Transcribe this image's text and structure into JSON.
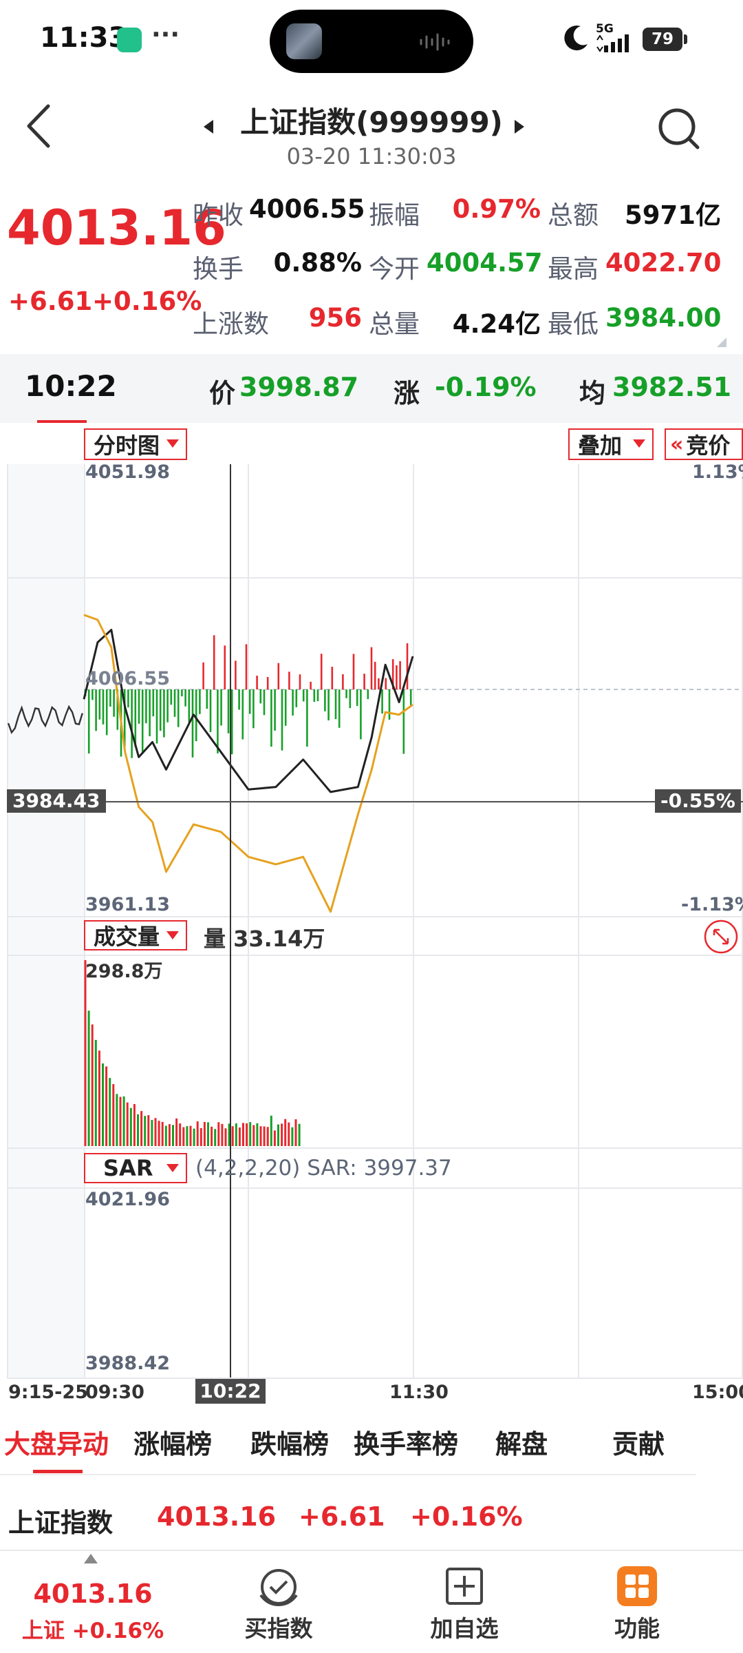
{
  "status": {
    "time": "11:33",
    "more": "···",
    "network": "5G",
    "battery": "79"
  },
  "header": {
    "title": "上证指数(999999)",
    "datetime": "03-20 11:30:03"
  },
  "quote": {
    "price": "4013.16",
    "change": "+6.61",
    "change_pct": "+0.16%",
    "rows": [
      [
        {
          "label": "昨收",
          "value": "4006.55",
          "color": "black"
        },
        {
          "label": "振幅",
          "value": "0.97%",
          "color": "red"
        },
        {
          "label": "总额",
          "value": "5971亿",
          "color": "black"
        }
      ],
      [
        {
          "label": "换手",
          "value": "0.88%",
          "color": "black"
        },
        {
          "label": "今开",
          "value": "4004.57",
          "color": "green"
        },
        {
          "label": "最高",
          "value": "4022.70",
          "color": "red"
        }
      ],
      [
        {
          "label": "上涨数",
          "value": "956",
          "color": "red"
        },
        {
          "label": "总量",
          "value": "4.24亿",
          "color": "black"
        },
        {
          "label": "最低",
          "value": "3984.00",
          "color": "green"
        }
      ]
    ]
  },
  "crosshair": {
    "time": "10:22",
    "price_label": "价",
    "price": "3998.87",
    "change_label": "涨",
    "change": "-0.19%",
    "avg_label": "均",
    "avg": "3982.51",
    "axis_price": "3984.43",
    "axis_pct": "-0.55%"
  },
  "chart": {
    "mode": "分时图",
    "overlay": "叠加",
    "auction": "竞价",
    "y_max": "4051.98",
    "y_mid": "4006.55",
    "y_min": "3961.13",
    "pct_max": "1.13%",
    "pct_min": "-1.13%",
    "volume_indicator": "成交量",
    "volume_value_label": "量 33.14万",
    "volume_max": "298.8万",
    "sar_indicator": "SAR",
    "sar_params": "(4,2,2,20) SAR: 3997.37",
    "sar_max": "4021.96",
    "sar_min": "3988.42",
    "x_labels": [
      "9:15-25",
      "09:30",
      "11:30",
      "15:00"
    ],
    "x_cursor": "10:22"
  },
  "chart_data": {
    "type": "line",
    "title": "上证指数(999999)",
    "y_range": [
      3961.13,
      4051.98
    ],
    "prev_close": 4006.55,
    "series": [
      {
        "name": "上证指数",
        "color": "#222222",
        "x": [
          "09:30",
          "09:35",
          "09:40",
          "09:45",
          "09:50",
          "09:55",
          "10:00",
          "10:10",
          "10:20",
          "10:30",
          "10:40",
          "10:50",
          "11:00",
          "11:10",
          "11:15",
          "11:20",
          "11:25",
          "11:30"
        ],
        "values": [
          4004.6,
          4016.0,
          4018.5,
          4003.0,
          3993.0,
          3996.0,
          3990.5,
          4001.5,
          3994.0,
          3986.5,
          3987.0,
          3992.5,
          3986.0,
          3987.0,
          3997.0,
          4011.5,
          4004.0,
          4013.2
        ]
      },
      {
        "name": "均价",
        "color": "#e6a11e",
        "x": [
          "09:30",
          "09:35",
          "09:40",
          "09:45",
          "09:50",
          "09:55",
          "10:00",
          "10:10",
          "10:20",
          "10:30",
          "10:40",
          "10:50",
          "11:00",
          "11:10",
          "11:15",
          "11:20",
          "11:25",
          "11:30"
        ],
        "values": [
          4021.5,
          4020.5,
          4015.0,
          3994.0,
          3983.0,
          3980.0,
          3970.0,
          3979.5,
          3978.0,
          3973.0,
          3971.5,
          3973.0,
          3962.0,
          3981.5,
          3990.5,
          4002.0,
          4001.5,
          4003.5
        ]
      }
    ]
  },
  "tabs": [
    "大盘异动",
    "涨幅榜",
    "跌幅榜",
    "换手率榜",
    "解盘",
    "贡献"
  ],
  "ticker": {
    "name": "上证指数",
    "price": "4013.16",
    "change": "+6.61",
    "change_pct": "+0.16%"
  },
  "bottom_nav": {
    "price": "4013.16",
    "sub": "上证 +0.16%",
    "items": [
      {
        "label": "买指数"
      },
      {
        "label": "加自选"
      },
      {
        "label": "功能"
      }
    ]
  },
  "colors": {
    "up": "#e6282e",
    "down": "#16a028",
    "avg": "#e6a11e",
    "accent": "#f47d20"
  }
}
